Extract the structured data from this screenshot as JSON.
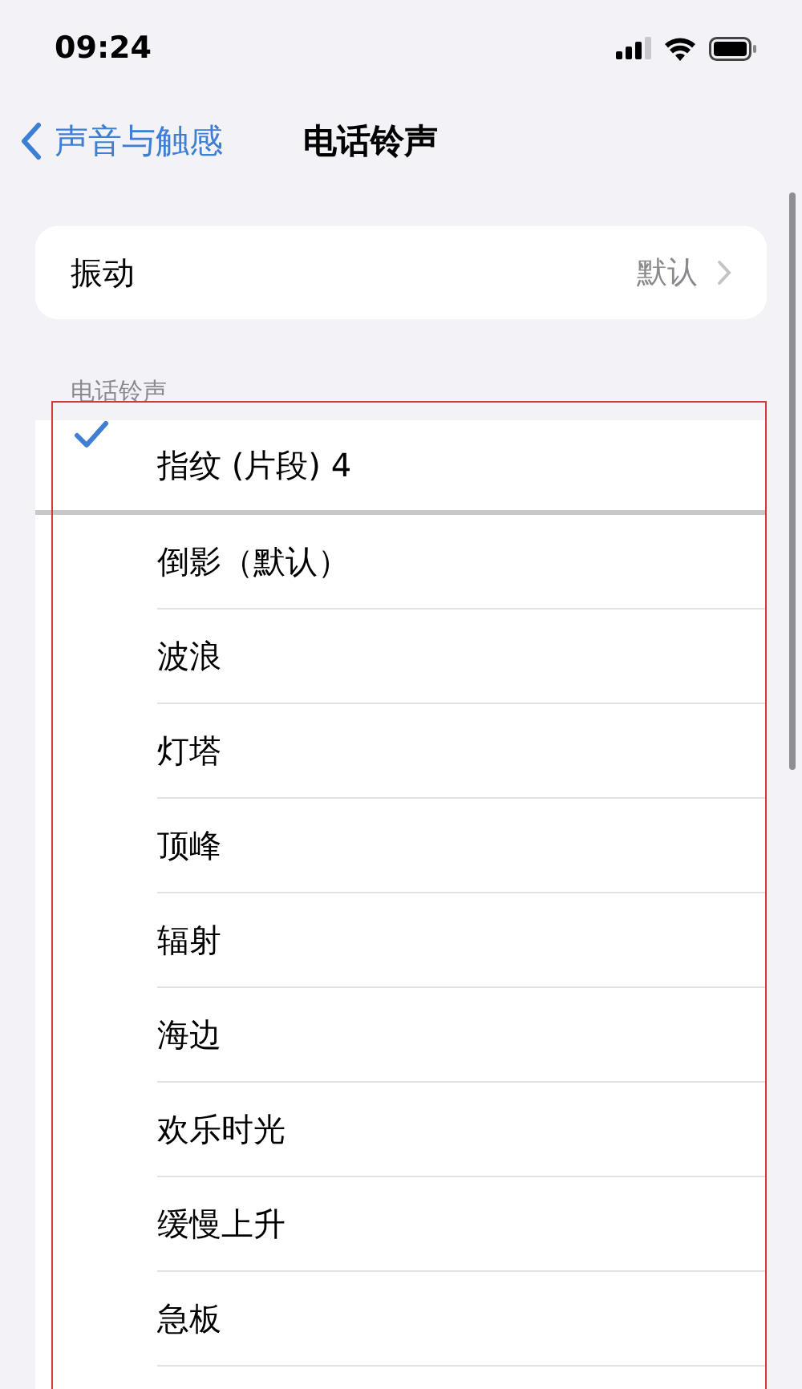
{
  "status_bar": {
    "time": "09:24"
  },
  "nav": {
    "back": "声音与触感",
    "title": "电话铃声"
  },
  "vibration": {
    "label": "振动",
    "value": "默认"
  },
  "ringtones": {
    "header": "电话铃声",
    "items": [
      {
        "label": "指纹 (片段) 4",
        "selected": true
      },
      {
        "label": "倒影（默认）",
        "selected": false
      },
      {
        "label": "波浪",
        "selected": false
      },
      {
        "label": "灯塔",
        "selected": false
      },
      {
        "label": "顶峰",
        "selected": false
      },
      {
        "label": "辐射",
        "selected": false
      },
      {
        "label": "海边",
        "selected": false
      },
      {
        "label": "欢乐时光",
        "selected": false
      },
      {
        "label": "缓慢上升",
        "selected": false
      },
      {
        "label": "急板",
        "selected": false
      }
    ]
  }
}
